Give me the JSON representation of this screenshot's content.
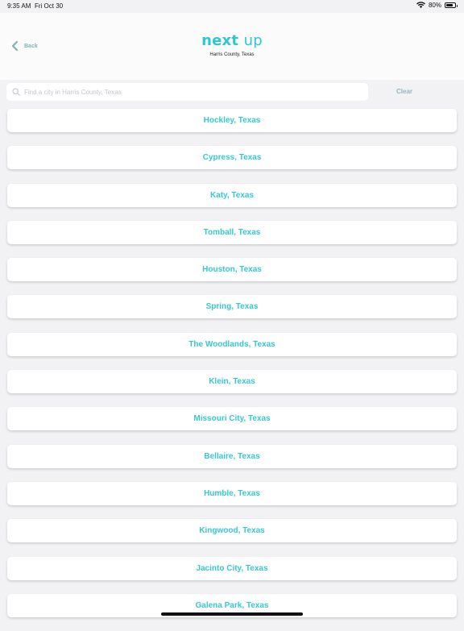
{
  "status_bar": {
    "time": "9:35 AM",
    "date": "Fri Oct 30",
    "battery": "80%",
    "battery_level": 0.8
  },
  "header": {
    "back_label": "Back",
    "logo_main": "next",
    "logo_accent": "up",
    "subtitle": "Harris County, Texas"
  },
  "search": {
    "placeholder": "Find a city in Harris County, Texas",
    "value": "",
    "clear_label": "Clear"
  },
  "cities": [
    {
      "label": "Hockley, Texas"
    },
    {
      "label": "Cypress, Texas"
    },
    {
      "label": "Katy, Texas"
    },
    {
      "label": "Tomball, Texas"
    },
    {
      "label": "Houston, Texas"
    },
    {
      "label": "Spring, Texas"
    },
    {
      "label": "The Woodlands, Texas"
    },
    {
      "label": "Klein, Texas"
    },
    {
      "label": "Missouri City, Texas"
    },
    {
      "label": "Bellaire, Texas"
    },
    {
      "label": "Humble, Texas"
    },
    {
      "label": "Kingwood, Texas"
    },
    {
      "label": "Jacinto City, Texas"
    },
    {
      "label": "Galena Park, Texas"
    }
  ],
  "colors": {
    "accent": "#36c8d2",
    "logo": "#2fc6d4",
    "muted_accent": "#7fb3b8",
    "background": "#f2f2f4"
  },
  "icons": [
    "wifi-icon",
    "battery-icon",
    "chevron-left-icon",
    "search-icon"
  ]
}
